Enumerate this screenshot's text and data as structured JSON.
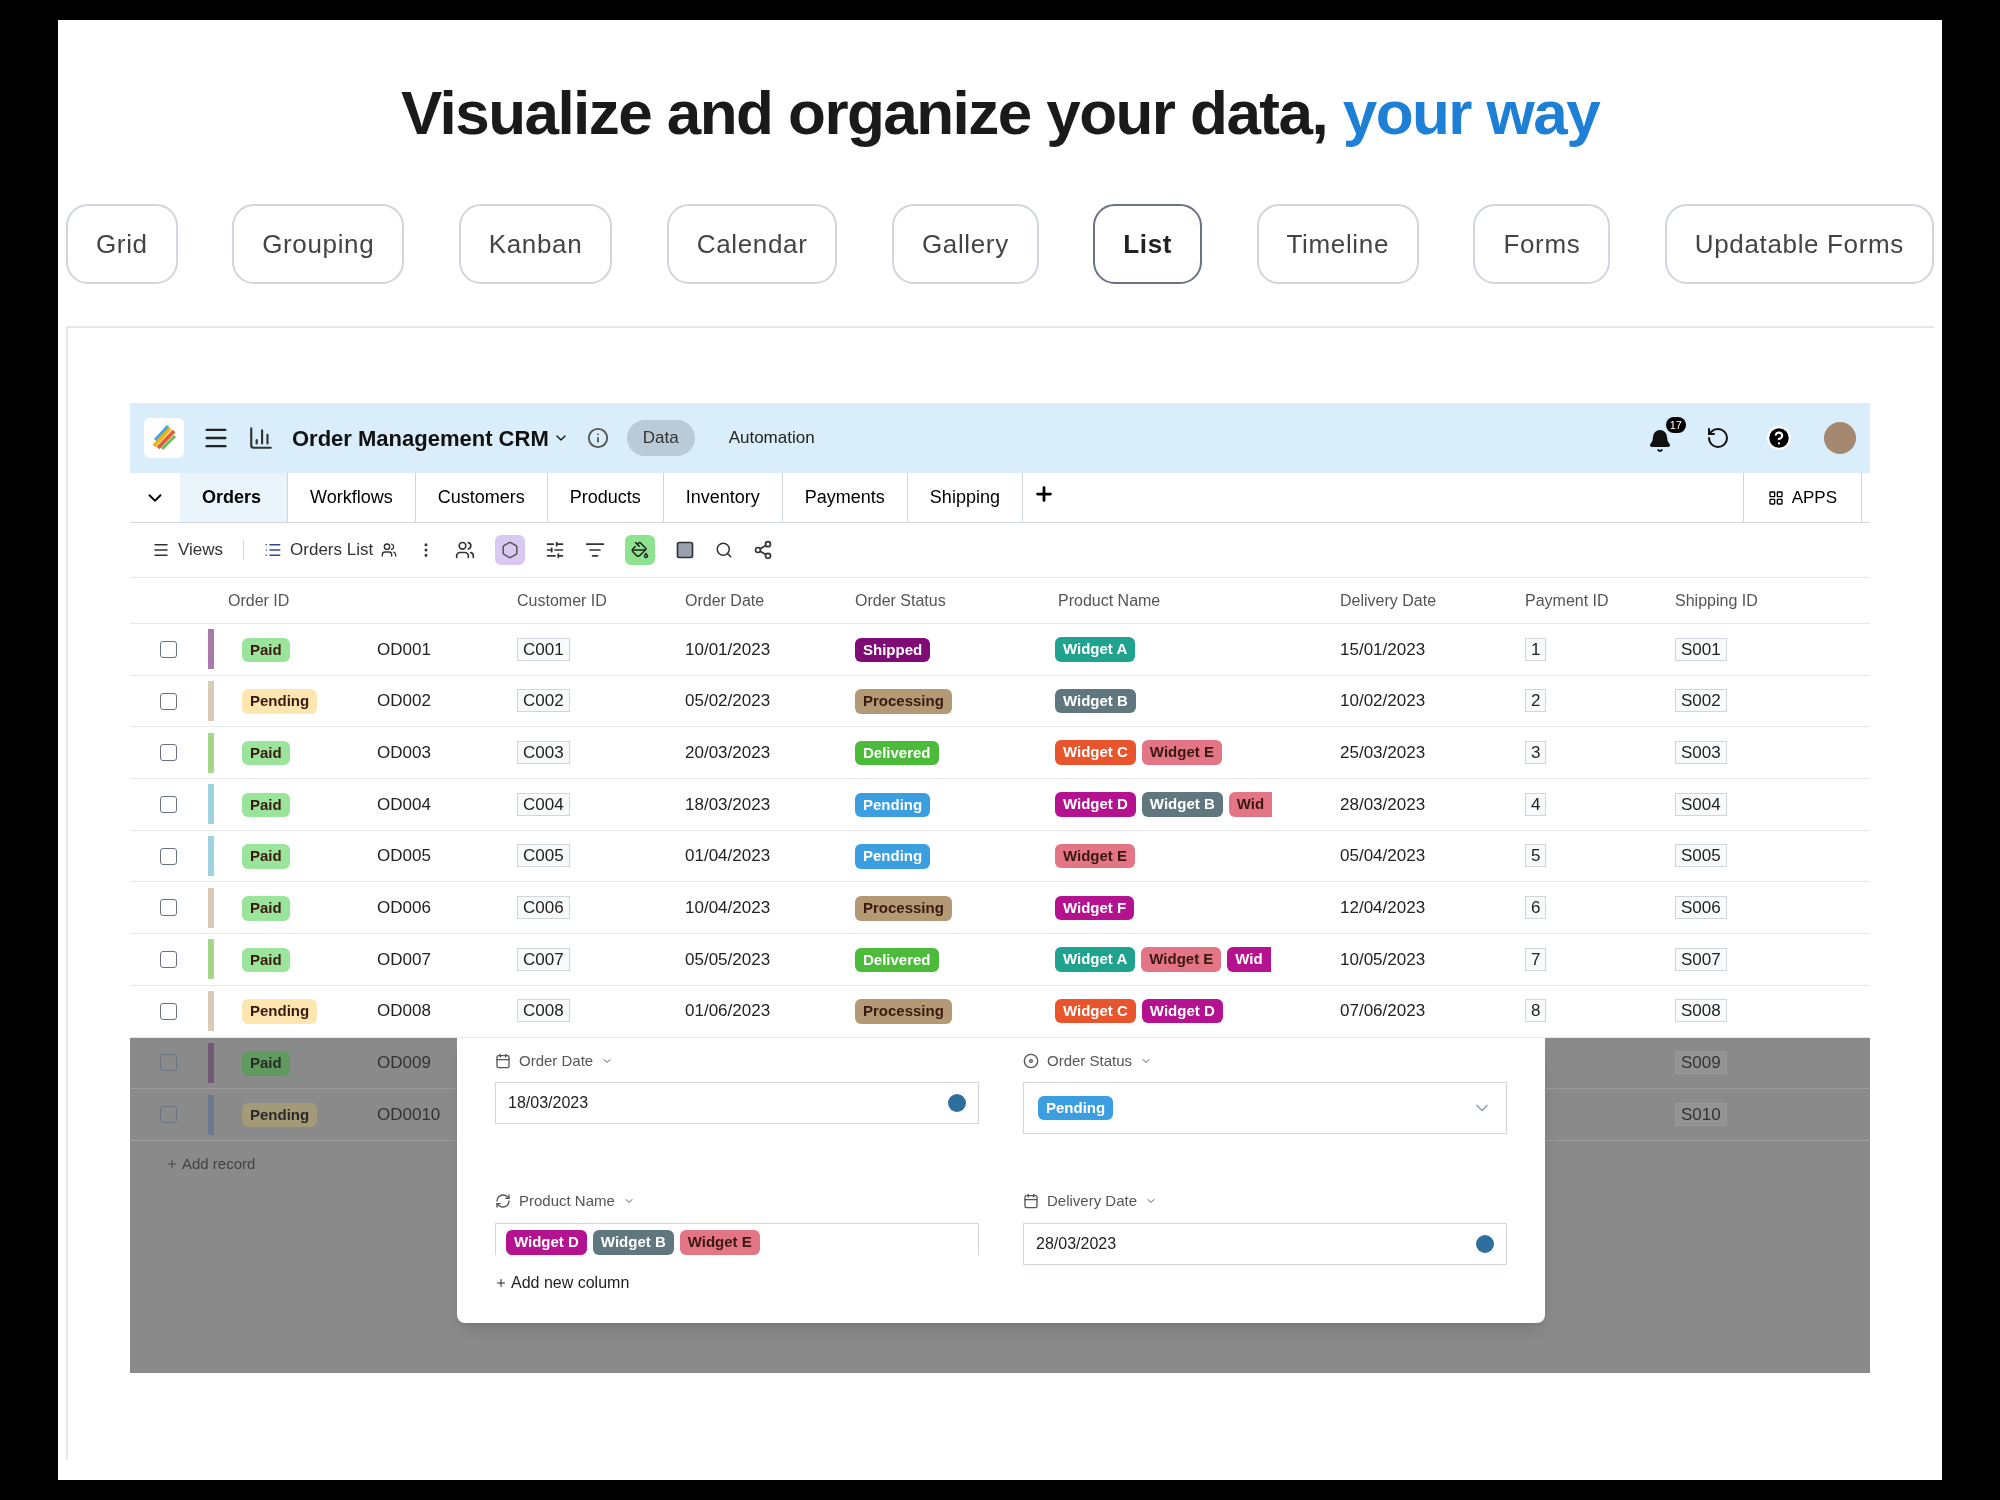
{
  "heading": {
    "text": "Visualize and organize your data, ",
    "accent": "your way"
  },
  "view_tabs": [
    {
      "label": "Grid",
      "selected": false
    },
    {
      "label": "Grouping",
      "selected": false
    },
    {
      "label": "Kanban",
      "selected": false
    },
    {
      "label": "Calendar",
      "selected": false
    },
    {
      "label": "Gallery",
      "selected": false
    },
    {
      "label": "List",
      "selected": true
    },
    {
      "label": "Timeline",
      "selected": false
    },
    {
      "label": "Forms",
      "selected": false
    },
    {
      "label": "Updatable Forms",
      "selected": false
    }
  ],
  "app": {
    "title": "Order Management CRM",
    "nav": [
      {
        "label": "Data",
        "selected": true
      },
      {
        "label": "Automation",
        "selected": false
      }
    ],
    "notifications": "17",
    "table_tabs": [
      {
        "label": "Orders",
        "selected": true
      },
      {
        "label": "Workflows",
        "selected": false
      },
      {
        "label": "Customers",
        "selected": false
      },
      {
        "label": "Products",
        "selected": false
      },
      {
        "label": "Inventory",
        "selected": false
      },
      {
        "label": "Payments",
        "selected": false
      },
      {
        "label": "Shipping",
        "selected": false
      }
    ],
    "apps_button": "APPS",
    "toolbar": {
      "views": "Views",
      "view_name": "Orders List"
    },
    "columns": [
      "Order ID",
      "Customer ID",
      "Order Date",
      "Order Status",
      "Product Name",
      "Delivery Date",
      "Payment ID",
      "Shipping ID"
    ],
    "rows": [
      {
        "checked": false,
        "color": "#a97aa8",
        "payment": {
          "label": "Paid",
          "color": "#9be49b"
        },
        "order_id": "OD001",
        "customer_id": "C001",
        "order_date": "10/01/2023",
        "status": {
          "label": "Shipped",
          "color": "#7e0c74"
        },
        "products": [
          {
            "label": "Widget A",
            "color": "#1fa38f"
          }
        ],
        "delivery_date": "15/01/2023",
        "payment_id": "1",
        "shipping_id": "S001"
      },
      {
        "checked": false,
        "color": "#d9cbb8",
        "payment": {
          "label": "Pending",
          "color": "#fde6b0"
        },
        "order_id": "OD002",
        "customer_id": "C002",
        "order_date": "05/02/2023",
        "status": {
          "label": "Processing",
          "color": "#b39a74"
        },
        "products": [
          {
            "label": "Widget B",
            "color": "#607780"
          }
        ],
        "delivery_date": "10/02/2023",
        "payment_id": "2",
        "shipping_id": "S002"
      },
      {
        "checked": false,
        "color": "#a6d68a",
        "payment": {
          "label": "Paid",
          "color": "#9be49b"
        },
        "order_id": "OD003",
        "customer_id": "C003",
        "order_date": "20/03/2023",
        "status": {
          "label": "Delivered",
          "color": "#4cbb3a"
        },
        "products": [
          {
            "label": "Widget C",
            "color": "#e8542b"
          },
          {
            "label": "Widget E",
            "color": "#e47585"
          }
        ],
        "delivery_date": "25/03/2023",
        "payment_id": "3",
        "shipping_id": "S003"
      },
      {
        "checked": false,
        "color": "#9fd3e0",
        "payment": {
          "label": "Paid",
          "color": "#9be49b"
        },
        "order_id": "OD004",
        "customer_id": "C004",
        "order_date": "18/03/2023",
        "status": {
          "label": "Pending",
          "color": "#3a9ee0"
        },
        "products": [
          {
            "label": "Widget D",
            "color": "#b5128f"
          },
          {
            "label": "Widget B",
            "color": "#607780"
          },
          {
            "label": "Wid",
            "color": "#e47585"
          }
        ],
        "delivery_date": "28/03/2023",
        "payment_id": "4",
        "shipping_id": "S004"
      },
      {
        "checked": false,
        "color": "#9fd3e0",
        "payment": {
          "label": "Paid",
          "color": "#9be49b"
        },
        "order_id": "OD005",
        "customer_id": "C005",
        "order_date": "01/04/2023",
        "status": {
          "label": "Pending",
          "color": "#3a9ee0"
        },
        "products": [
          {
            "label": "Widget E",
            "color": "#e47585"
          }
        ],
        "delivery_date": "05/04/2023",
        "payment_id": "5",
        "shipping_id": "S005"
      },
      {
        "checked": false,
        "color": "#d9cbb8",
        "payment": {
          "label": "Paid",
          "color": "#9be49b"
        },
        "order_id": "OD006",
        "customer_id": "C006",
        "order_date": "10/04/2023",
        "status": {
          "label": "Processing",
          "color": "#b39a74"
        },
        "products": [
          {
            "label": "Widget F",
            "color": "#b5128f"
          }
        ],
        "delivery_date": "12/04/2023",
        "payment_id": "6",
        "shipping_id": "S006"
      },
      {
        "checked": false,
        "color": "#a6d68a",
        "payment": {
          "label": "Paid",
          "color": "#9be49b"
        },
        "order_id": "OD007",
        "customer_id": "C007",
        "order_date": "05/05/2023",
        "status": {
          "label": "Delivered",
          "color": "#4cbb3a"
        },
        "products": [
          {
            "label": "Widget A",
            "color": "#1fa38f"
          },
          {
            "label": "Widget E",
            "color": "#e47585"
          },
          {
            "label": "Wid",
            "color": "#b5128f"
          }
        ],
        "delivery_date": "10/05/2023",
        "payment_id": "7",
        "shipping_id": "S007"
      },
      {
        "checked": false,
        "color": "#d9cbb8",
        "payment": {
          "label": "Pending",
          "color": "#fde6b0"
        },
        "order_id": "OD008",
        "customer_id": "C008",
        "order_date": "01/06/2023",
        "status": {
          "label": "Processing",
          "color": "#b39a74"
        },
        "products": [
          {
            "label": "Widget C",
            "color": "#e8542b"
          },
          {
            "label": "Widget D",
            "color": "#b5128f"
          }
        ],
        "delivery_date": "07/06/2023",
        "payment_id": "8",
        "shipping_id": "S008"
      }
    ],
    "dimmed_rows": [
      {
        "checked": false,
        "color": "#6e5a72",
        "payment": {
          "label": "Paid",
          "color": "#5f9a5f"
        },
        "order_id": "OD009",
        "shipping_id": "S009"
      },
      {
        "checked": false,
        "color": "#6a7890",
        "payment": {
          "label": "Pending",
          "color": "#a39a78"
        },
        "order_id": "OD0010",
        "shipping_id": "S010"
      }
    ],
    "add_record": "Add record",
    "modal": {
      "fields": [
        {
          "kind": "date",
          "label": "Order Date",
          "value": "18/03/2023"
        },
        {
          "kind": "select",
          "label": "Order Status",
          "tags": [
            {
              "label": "Pending",
              "color": "#3a9ee0"
            }
          ]
        },
        {
          "kind": "tags",
          "label": "Product Name",
          "tags": [
            {
              "label": "Widget D",
              "color": "#b5128f"
            },
            {
              "label": "Widget B",
              "color": "#607780"
            },
            {
              "label": "Widget E",
              "color": "#e47585"
            }
          ]
        },
        {
          "kind": "date",
          "label": "Delivery Date",
          "value": "28/03/2023"
        }
      ],
      "add_column": "Add new column"
    }
  }
}
